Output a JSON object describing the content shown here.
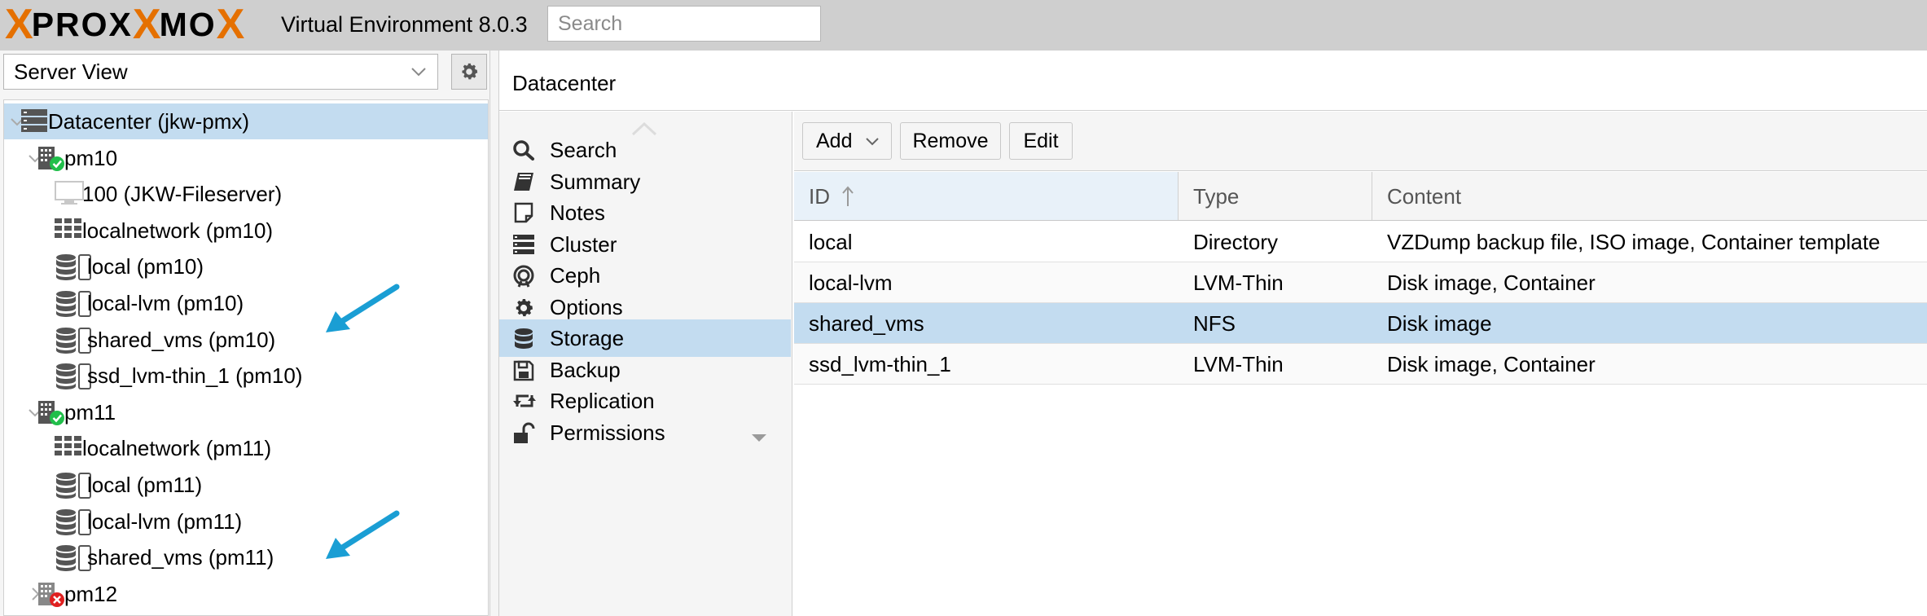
{
  "header": {
    "logo": {
      "x1": "X",
      "prox": "PROX",
      "mo": "MO",
      "x2": "X"
    },
    "product": "Virtual Environment 8.0.3",
    "search_placeholder": "Search"
  },
  "left": {
    "view_select": "Server View",
    "tree": [
      {
        "label": "Datacenter (jkw-pmx)",
        "icon": "datacenter-icon",
        "level": 0,
        "toggle": "expanded",
        "selected": true
      },
      {
        "label": "pm10",
        "icon": "node-online-icon",
        "level": 1,
        "toggle": "expanded"
      },
      {
        "label": "100 (JKW-Fileserver)",
        "icon": "vm-icon",
        "level": 2
      },
      {
        "label": "localnetwork (pm10)",
        "icon": "sdn-icon",
        "level": 2
      },
      {
        "label": "local (pm10)",
        "icon": "storage-icon",
        "level": 2
      },
      {
        "label": "local-lvm (pm10)",
        "icon": "storage-icon",
        "level": 2
      },
      {
        "label": "shared_vms (pm10)",
        "icon": "storage-icon",
        "level": 2,
        "arrow": true
      },
      {
        "label": "ssd_lvm-thin_1 (pm10)",
        "icon": "storage-icon",
        "level": 2
      },
      {
        "label": "pm11",
        "icon": "node-online-icon",
        "level": 1,
        "toggle": "expanded"
      },
      {
        "label": "localnetwork (pm11)",
        "icon": "sdn-icon",
        "level": 2
      },
      {
        "label": "local (pm11)",
        "icon": "storage-icon",
        "level": 2
      },
      {
        "label": "local-lvm (pm11)",
        "icon": "storage-icon",
        "level": 2
      },
      {
        "label": "shared_vms (pm11)",
        "icon": "storage-icon",
        "level": 2,
        "arrow": true
      },
      {
        "label": "pm12",
        "icon": "node-offline-icon",
        "level": 1,
        "toggle": "collapsed"
      }
    ]
  },
  "content": {
    "title": "Datacenter",
    "nav": [
      {
        "label": "Search",
        "icon": "search-icon"
      },
      {
        "label": "Summary",
        "icon": "book-icon"
      },
      {
        "label": "Notes",
        "icon": "note-icon"
      },
      {
        "label": "Cluster",
        "icon": "server-icon"
      },
      {
        "label": "Ceph",
        "icon": "ceph-icon"
      },
      {
        "label": "Options",
        "icon": "gear-icon"
      },
      {
        "label": "Storage",
        "icon": "database-icon",
        "active": true
      },
      {
        "label": "Backup",
        "icon": "floppy-icon"
      },
      {
        "label": "Replication",
        "icon": "retweet-icon"
      },
      {
        "label": "Permissions",
        "icon": "unlock-icon"
      }
    ],
    "toolbar": {
      "add": "Add",
      "remove": "Remove",
      "edit": "Edit"
    },
    "grid": {
      "columns": [
        "ID",
        "Type",
        "Content"
      ],
      "rows": [
        {
          "id": "local",
          "type": "Directory",
          "content": "VZDump backup file, ISO image, Container template"
        },
        {
          "id": "local-lvm",
          "type": "LVM-Thin",
          "content": "Disk image, Container"
        },
        {
          "id": "shared_vms",
          "type": "NFS",
          "content": "Disk image",
          "selected": true
        },
        {
          "id": "ssd_lvm-thin_1",
          "type": "LVM-Thin",
          "content": "Disk image, Container"
        }
      ]
    }
  },
  "colors": {
    "accent": "#e57000",
    "selection": "#c3dcf0",
    "arrow": "#1a9ed4",
    "online": "#21bf4b",
    "offline": "#e02020"
  }
}
